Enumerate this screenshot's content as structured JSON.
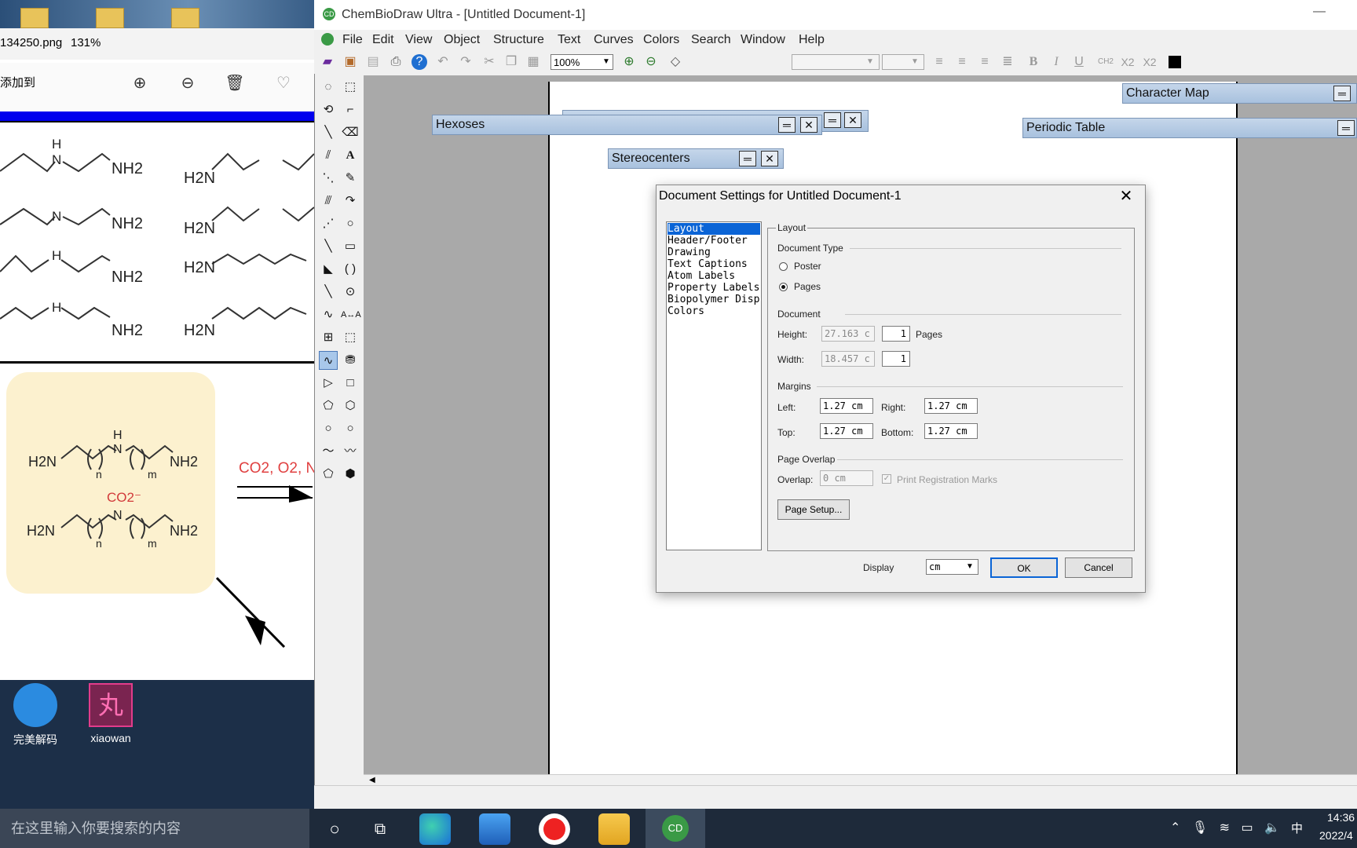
{
  "viewer": {
    "filename": "134250.png",
    "zoom": "131%",
    "add_to": "添加到",
    "chem_labels": {
      "nh2": "NH2",
      "h2n": "H2N",
      "nh": "H",
      "n": "N",
      "co2_gas": "CO2, O2, N",
      "co2_ion": "CO2⁻",
      "n_sub": "n",
      "m_sub": "m"
    }
  },
  "desktop": {
    "icons": [
      {
        "label": "完美解码"
      },
      {
        "label": "xiaowan"
      }
    ]
  },
  "taskbar": {
    "search_placeholder": "在这里输入你要搜索的内容",
    "clock_time": "14:36",
    "clock_date": "2022/4",
    "ime": "中"
  },
  "app": {
    "title": "ChemBioDraw Ultra - [Untitled Document-1]",
    "menu": [
      "File",
      "Edit",
      "View",
      "Object",
      "Structure",
      "Text",
      "Curves",
      "Colors",
      "Search",
      "Window",
      "Help"
    ],
    "zoom": "100%",
    "text_style": {
      "subscript_ch2": "CH2",
      "subscript": "X2",
      "superscript": "X2"
    },
    "palettes": {
      "hexoses": "Hexoses",
      "stereocenters": "Stereocenters",
      "character_map": "Character Map",
      "periodic_table": "Periodic Table"
    }
  },
  "dialog": {
    "title": "Document Settings for Untitled Document-1",
    "categories": [
      "Layout",
      "Header/Footer",
      "Drawing",
      "Text Captions",
      "Atom Labels",
      "Property Labels",
      "Biopolymer Disp",
      "Colors"
    ],
    "selected_category": "Layout",
    "group_title": "Layout",
    "document_type": {
      "label": "Document Type",
      "options": [
        "Poster",
        "Pages"
      ],
      "selected": "Pages"
    },
    "document": {
      "label": "Document",
      "height_label": "Height:",
      "height_value": "27.163 c",
      "height_pages": "1",
      "pages_label": "Pages",
      "width_label": "Width:",
      "width_value": "18.457 c",
      "width_pages": "1"
    },
    "margins": {
      "label": "Margins",
      "left_label": "Left:",
      "left": "1.27 cm",
      "right_label": "Right:",
      "right": "1.27 cm",
      "top_label": "Top:",
      "top": "1.27 cm",
      "bottom_label": "Bottom:",
      "bottom": "1.27 cm"
    },
    "page_overlap": {
      "label": "Page Overlap",
      "overlap_label": "Overlap:",
      "overlap_value": "0 cm",
      "print_marks": "Print Registration Marks",
      "print_marks_checked": true
    },
    "page_setup_button": "Page Setup...",
    "display_label": "Display",
    "display_unit": "cm",
    "ok": "OK",
    "cancel": "Cancel"
  }
}
